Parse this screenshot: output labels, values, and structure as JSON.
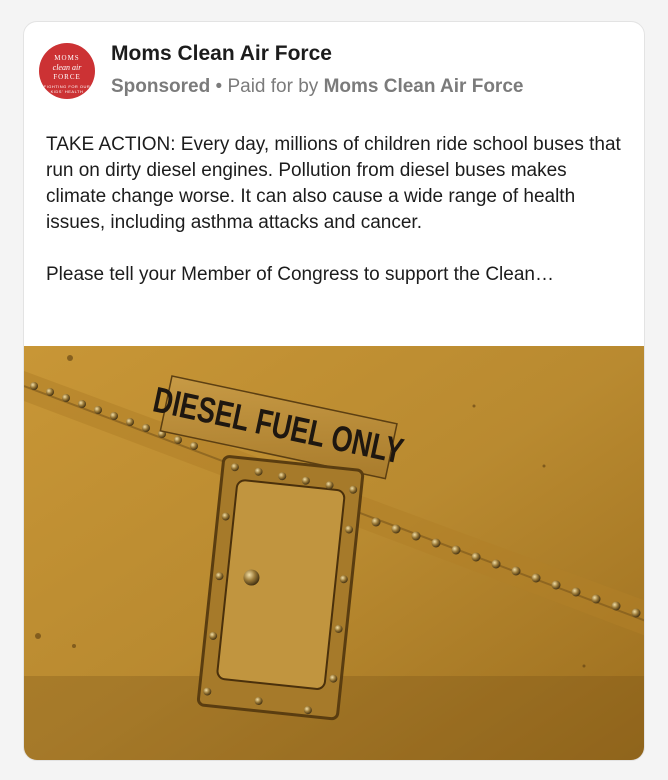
{
  "post": {
    "avatar": {
      "line1": "MOMS",
      "line2": "clean air",
      "line3": "FORCE",
      "line4": "FIGHTING FOR OUR KIDS' HEALTH"
    },
    "page_name": "Moms Clean Air Force",
    "sponsored_label": "Sponsored",
    "separator": "•",
    "paid_for_prefix": "Paid for by",
    "paid_for_name": "Moms Clean Air Force",
    "body_paragraph_1": "TAKE ACTION: Every day, millions of children ride school buses that run on dirty diesel engines. Pollution from diesel buses makes climate change worse. It can also cause a wide range of health issues, including asthma attacks and cancer.",
    "body_paragraph_2": "Please tell your Member of Congress to support the Clean…",
    "image": {
      "label_text": "DIESEL FUEL ONLY",
      "colors": {
        "bus_yellow": "#c08e33",
        "label_plate": "#b58838",
        "rivet": "#8a6a2c"
      }
    }
  }
}
